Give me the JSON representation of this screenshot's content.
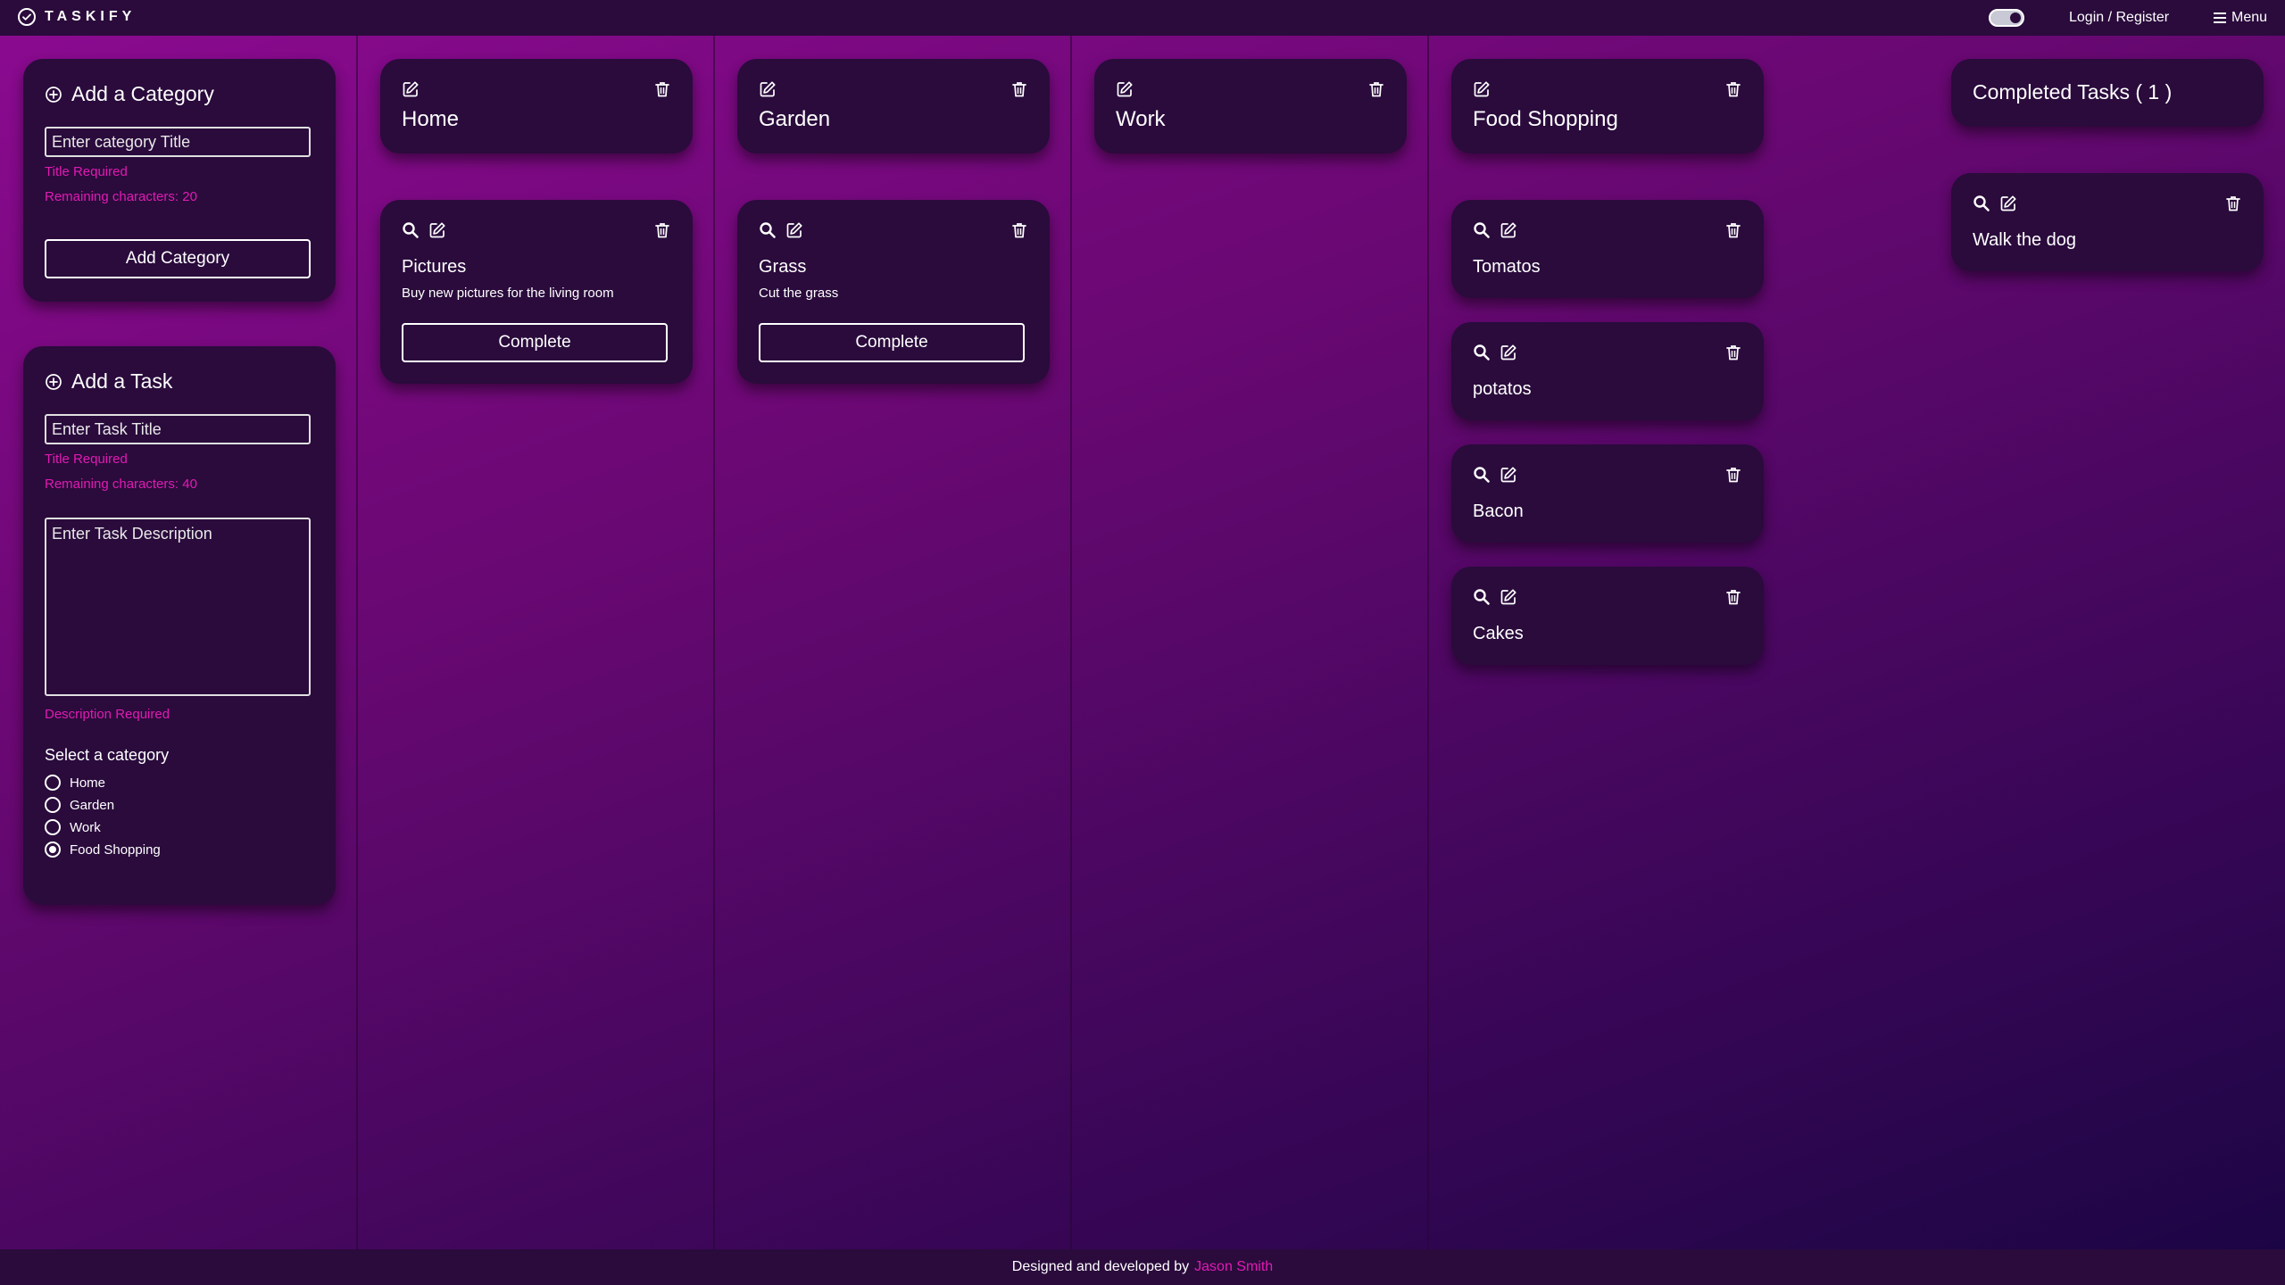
{
  "brand": {
    "name": "TASKIFY"
  },
  "header": {
    "login_label": "Login / Register",
    "menu_label": "Menu"
  },
  "footer": {
    "prefix": "Designed and developed by",
    "author": "Jason Smith"
  },
  "add_category": {
    "heading": "Add a Category",
    "placeholder": "Enter category Title",
    "title_required": "Title Required",
    "remaining": "Remaining characters: 20",
    "button": "Add Category"
  },
  "add_task": {
    "heading": "Add a Task",
    "title_placeholder": "Enter Task Title",
    "title_required": "Title Required",
    "remaining": "Remaining characters: 40",
    "description_placeholder": "Enter Task Description",
    "description_required": "Description Required",
    "select_label": "Select a category",
    "options": [
      "Home",
      "Garden",
      "Work",
      "Food Shopping"
    ],
    "selected": "Food Shopping"
  },
  "categories": [
    {
      "title": "Home",
      "tasks": [
        {
          "title": "Pictures",
          "description": "Buy new pictures for the living room",
          "button": "Complete"
        }
      ]
    },
    {
      "title": "Garden",
      "tasks": [
        {
          "title": "Grass",
          "description": "Cut the grass",
          "button": "Complete"
        }
      ]
    },
    {
      "title": "Work",
      "tasks": []
    },
    {
      "title": "Food Shopping",
      "tasks": [
        {
          "title": "Tomatos"
        },
        {
          "title": "potatos"
        },
        {
          "title": "Bacon"
        },
        {
          "title": "Cakes"
        }
      ]
    }
  ],
  "completed": {
    "heading": "Completed Tasks ( 1 )",
    "tasks": [
      {
        "title": "Walk the dog"
      }
    ]
  },
  "icons": {
    "logo": "check-circle-icon",
    "edit": "edit-icon",
    "delete": "trash-icon",
    "view": "search-icon",
    "add": "plus-circle-icon",
    "menu": "menu-icon"
  },
  "colors": {
    "accent": "#e11ab3",
    "card": "#2a0b3c",
    "bar": "#2a0b3c"
  }
}
